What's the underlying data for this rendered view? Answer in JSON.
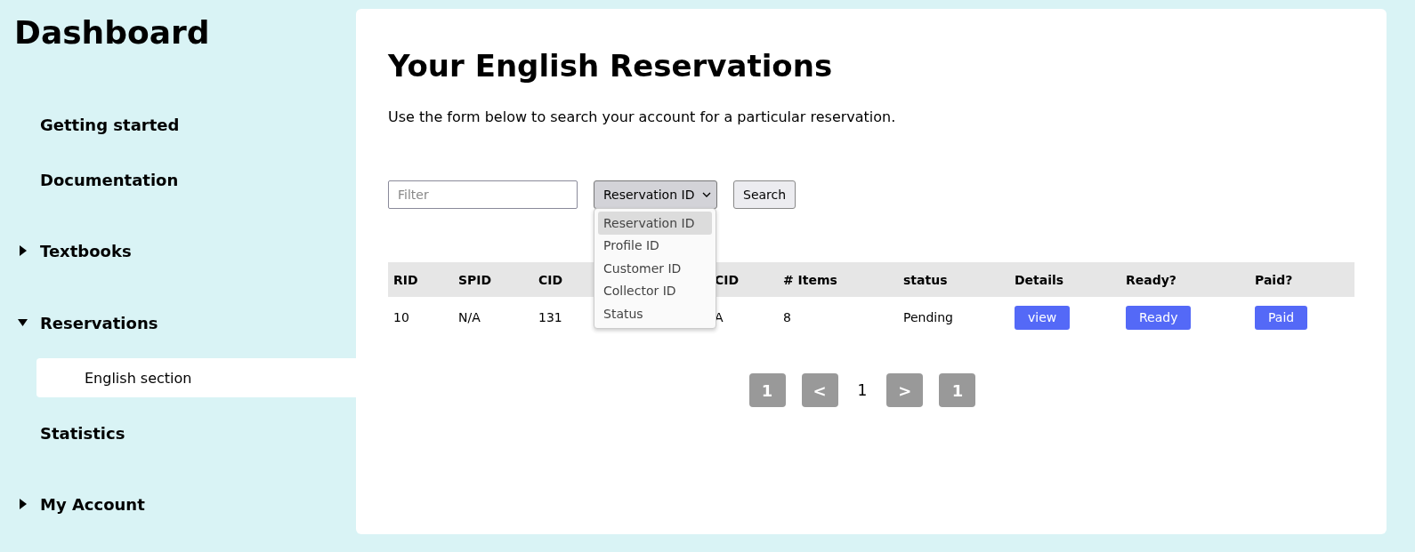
{
  "sidebar": {
    "title": "Dashboard",
    "items": [
      {
        "kind": "link",
        "label": "Getting started",
        "selected": false
      },
      {
        "kind": "link",
        "label": "Documentation",
        "selected": false
      },
      {
        "kind": "group",
        "label": "Textbooks",
        "selected": false,
        "expanded": false
      },
      {
        "kind": "group",
        "label": "Reservations",
        "selected": false,
        "expanded": true,
        "children": [
          {
            "label": "English section",
            "selected": true
          }
        ]
      },
      {
        "kind": "link",
        "label": "Statistics",
        "selected": false
      },
      {
        "kind": "group",
        "label": "My Account",
        "selected": false,
        "expanded": false
      }
    ]
  },
  "main": {
    "title": "Your English Reservations",
    "description": "Use the form below to search your account for a particular reservation.",
    "filter": {
      "placeholder": "Filter"
    },
    "select": {
      "value": "Reservation ID",
      "expanded": true,
      "options": [
        {
          "label": "Reservation ID",
          "selected": true
        },
        {
          "label": "Profile ID",
          "selected": false
        },
        {
          "label": "Customer ID",
          "selected": false
        },
        {
          "label": "Collector ID",
          "selected": false
        },
        {
          "label": "Status",
          "selected": false
        }
      ]
    },
    "search_button": "Search",
    "table": {
      "columns": [
        "RID",
        "SPID",
        "CID",
        "CID",
        "# Items",
        "status",
        "Details",
        "Ready?",
        "Paid?"
      ],
      "rows": [
        [
          {
            "kind": "text",
            "text": "10"
          },
          {
            "kind": "text",
            "text": "N/A"
          },
          {
            "kind": "text",
            "text": "131"
          },
          {
            "kind": "text",
            "text": "A"
          },
          {
            "kind": "text",
            "text": "8"
          },
          {
            "kind": "text",
            "text": "Pending"
          },
          {
            "kind": "button",
            "text": "view"
          },
          {
            "kind": "button",
            "text": "Ready"
          },
          {
            "kind": "button",
            "text": "Paid"
          }
        ]
      ]
    },
    "pagination": {
      "first": "1",
      "prev": "<",
      "current": "1",
      "next": ">",
      "last": "1"
    }
  }
}
